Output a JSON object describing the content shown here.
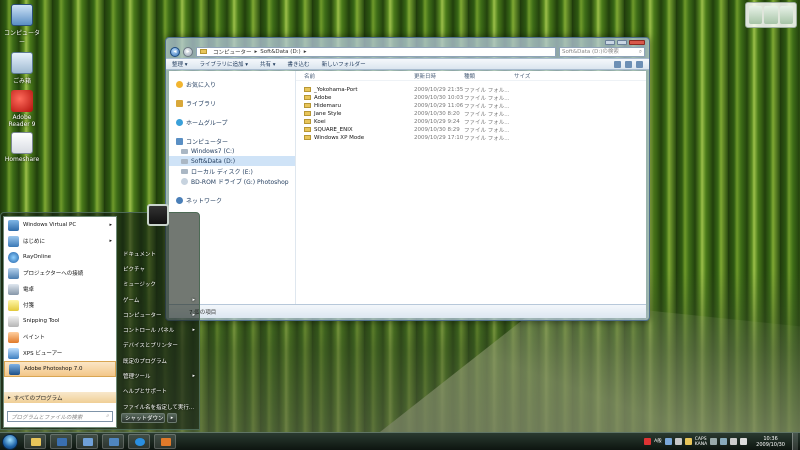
{
  "desktop": {
    "icons": [
      {
        "label": "コンピューター",
        "icon": "computer-icon"
      },
      {
        "label": "ごみ箱",
        "icon": "recycle-bin-icon"
      },
      {
        "label": "Adobe Reader 9",
        "icon": "acrobat-icon"
      },
      {
        "label": "Homeshare",
        "icon": "document-icon"
      }
    ]
  },
  "explorer": {
    "breadcrumb": [
      "コンピューター",
      "Soft&Data (D:)"
    ],
    "search_placeholder": "Soft&Data (D:)の検索",
    "toolbar": {
      "organize": "整理 ▾",
      "include_library": "ライブラリに追加 ▾",
      "share": "共有 ▾",
      "burn": "書き込む",
      "new_folder": "新しいフォルダー"
    },
    "nav": {
      "favorites": "お気に入り",
      "libraries": "ライブラリ",
      "homegroup": "ホームグループ",
      "computer": "コンピューター",
      "drives": [
        "Windows7 (C:)",
        "Soft&Data (D:)",
        "ローカル ディスク (E:)",
        "BD-ROM ドライブ (G:) Photoshop"
      ],
      "network": "ネットワーク"
    },
    "columns": {
      "name": "名前",
      "date": "更新日時",
      "type": "種類",
      "size": "サイズ"
    },
    "files": [
      {
        "name": "_Yokohama-Port",
        "date": "2009/10/29 21:35",
        "type": "ファイル フォル..."
      },
      {
        "name": "Adobe",
        "date": "2009/10/30 10:03",
        "type": "ファイル フォル..."
      },
      {
        "name": "Hidemaru",
        "date": "2009/10/29 11:06",
        "type": "ファイル フォル..."
      },
      {
        "name": "Jane Style",
        "date": "2009/10/30 8:20",
        "type": "ファイル フォル..."
      },
      {
        "name": "Koei",
        "date": "2009/10/29 9:24",
        "type": "ファイル フォル..."
      },
      {
        "name": "SQUARE_ENIX",
        "date": "2009/10/30 8:29",
        "type": "ファイル フォル..."
      },
      {
        "name": "Windows XP Mode",
        "date": "2009/10/29 17:10",
        "type": "ファイル フォル..."
      }
    ],
    "status": "7 個の項目"
  },
  "startmenu": {
    "programs": [
      {
        "label": "Windows Virtual PC",
        "arrow": "▸"
      },
      {
        "label": "はじめに",
        "arrow": "▸"
      },
      {
        "label": "RayOnline",
        "arrow": ""
      },
      {
        "label": "プロジェクターへの接続",
        "arrow": ""
      },
      {
        "label": "電卓",
        "arrow": ""
      },
      {
        "label": "付箋",
        "arrow": ""
      },
      {
        "label": "Snipping Tool",
        "arrow": ""
      },
      {
        "label": "ペイント",
        "arrow": ""
      },
      {
        "label": "XPS ビューアー",
        "arrow": ""
      },
      {
        "label": "Adobe Photoshop 7.0",
        "arrow": ""
      }
    ],
    "all_programs": "すべてのプログラム",
    "search_placeholder": "プログラムとファイルの検索",
    "links": [
      {
        "label": "ドキュメント",
        "arrow": ""
      },
      {
        "label": "ピクチャ",
        "arrow": ""
      },
      {
        "label": "ミュージック",
        "arrow": ""
      },
      {
        "label": "ゲーム",
        "arrow": "▸"
      },
      {
        "label": "コンピューター",
        "arrow": "▸"
      },
      {
        "label": "コントロール パネル",
        "arrow": "▸"
      },
      {
        "label": "デバイスとプリンター",
        "arrow": ""
      },
      {
        "label": "既定のプログラム",
        "arrow": ""
      },
      {
        "label": "管理ツール",
        "arrow": "▸"
      },
      {
        "label": "ヘルプとサポート",
        "arrow": ""
      },
      {
        "label": "ファイル名を指定して実行...",
        "arrow": ""
      }
    ],
    "shutdown": "シャットダウン",
    "shutdown_arrow": "▸"
  },
  "taskbar": {
    "lang_line1": "CAPS",
    "lang_line2": "KANA",
    "time": "10:36",
    "date": "2009/10/30"
  }
}
